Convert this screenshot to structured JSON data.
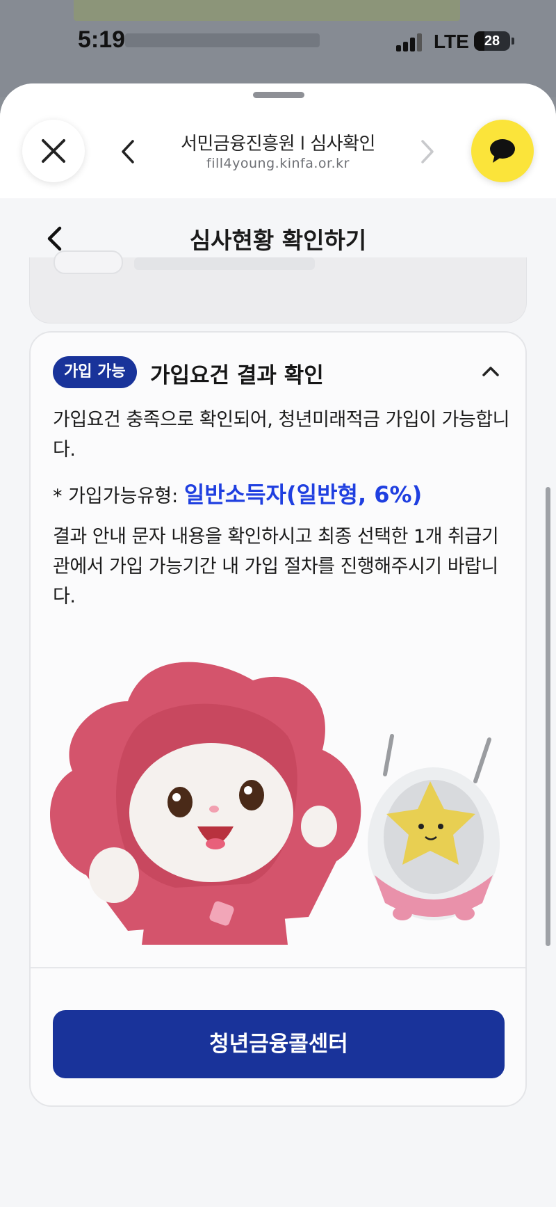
{
  "status_bar": {
    "time": "5:19",
    "network": "LTE",
    "battery": "28"
  },
  "browser_header": {
    "title": "서민금융진흥원 l 심사확인",
    "url": "fill4young.kinfa.or.kr",
    "icons": {
      "close": "close-icon",
      "back": "chevron-left-icon",
      "forward": "chevron-right-icon",
      "chat": "speech-bubble-icon"
    },
    "chat_color": "#fbe43a"
  },
  "page": {
    "title": "심사현황 확인하기"
  },
  "result_card": {
    "badge": "가입 가능",
    "title": "가입요건 결과 확인",
    "message": "가입요건 충족으로 확인되어, 청년미래적금 가입이 가능합니다.",
    "type_label": "* 가입가능유형: ",
    "type_value": "일반소득자(일반형, 6%)",
    "guide": "결과 안내 문자 내용을 확인하시고 최종 선택한 1개 취급기관에서 가입 가능기간 내 가입 절차를 진행해주시기 바랍니다.",
    "call_button": "청년금융콜센터",
    "accent_color": "#19339a",
    "highlight_color": "#1f3fe0"
  }
}
